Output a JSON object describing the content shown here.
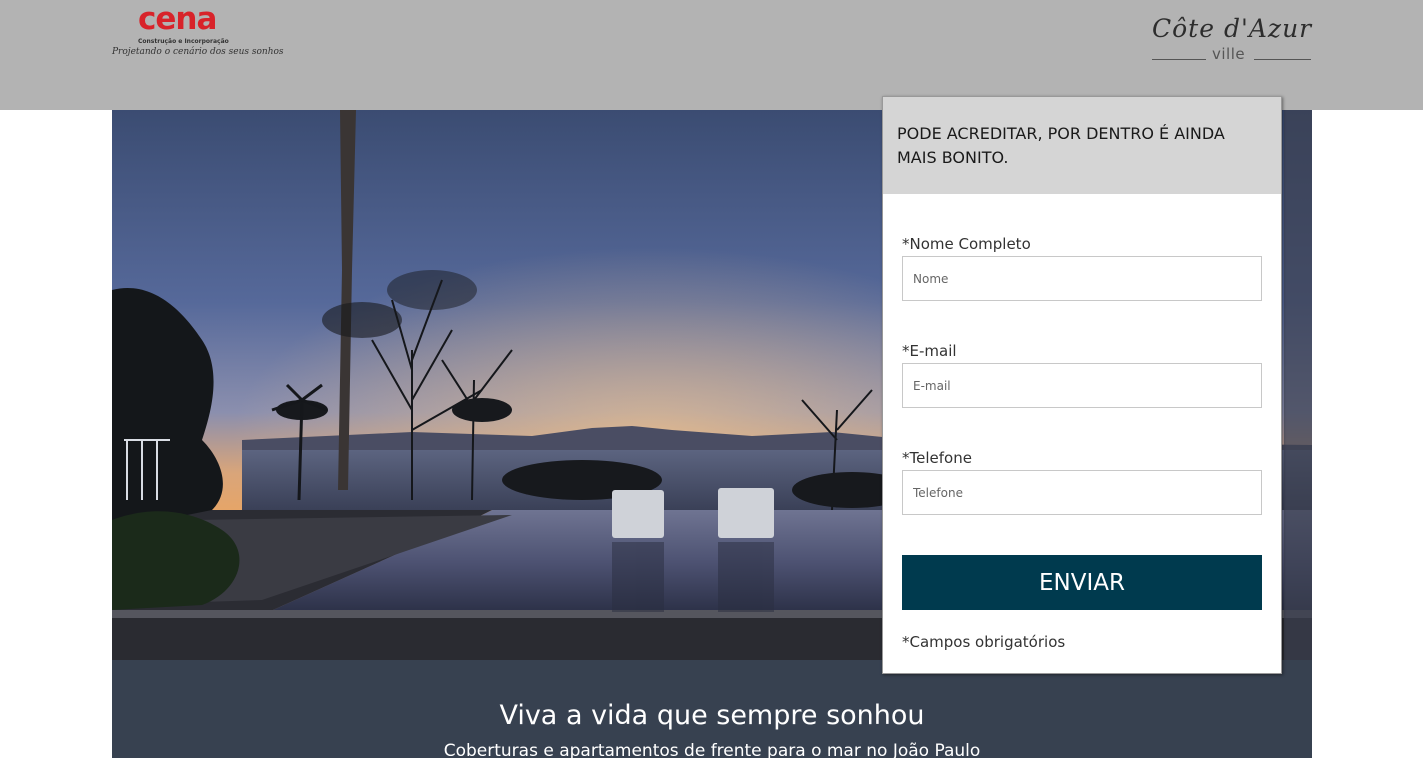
{
  "header": {
    "logo_left": {
      "brand": "cena",
      "subtitle": "Construção e Incorporação",
      "tagline": "Projetando o cenário dos seus sonhos"
    },
    "logo_right": {
      "script": "Côte d'Azur",
      "sub": "ville"
    }
  },
  "form": {
    "title": "PODE ACREDITAR, POR DENTRO É AINDA MAIS BONITO.",
    "fields": [
      {
        "label": "*Nome Completo",
        "placeholder": "Nome",
        "value": ""
      },
      {
        "label": "*E-mail",
        "placeholder": "E-mail",
        "value": ""
      },
      {
        "label": "*Telefone",
        "placeholder": "Telefone",
        "value": ""
      }
    ],
    "submit_label": "ENVIAR",
    "required_note": "*Campos obrigatórios"
  },
  "band": {
    "headline": "Viva a vida que sempre sonhou",
    "subline": "Coberturas e apartamentos de frente para o mar no João Paulo"
  },
  "colors": {
    "header_bg": "#b3b3b3",
    "brand_red": "#d8232a",
    "button_bg": "#003a4e",
    "band_bg": "#374150",
    "form_head_bg": "#d5d5d5"
  }
}
